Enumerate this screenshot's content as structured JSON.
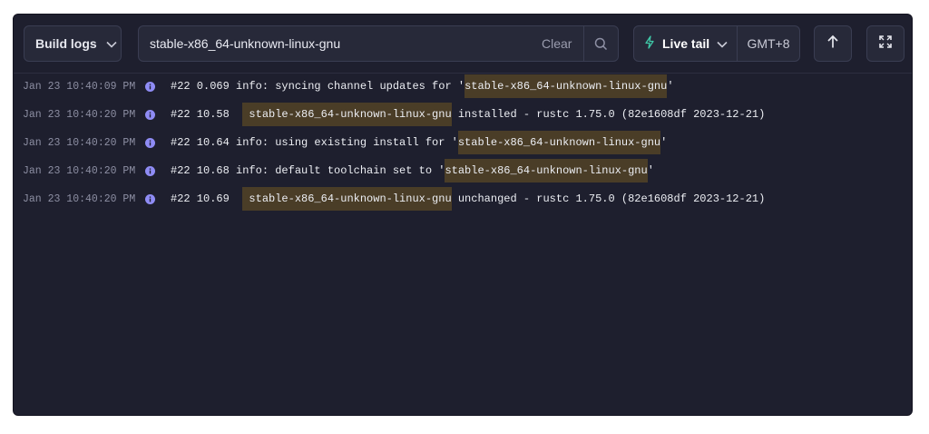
{
  "toolbar": {
    "source_label": "Build logs",
    "search_value": "stable-x86_64-unknown-linux-gnu",
    "clear_label": "Clear",
    "live_tail_label": "Live tail",
    "timezone_label": "GMT+8",
    "icons": {
      "source_dropdown": "chevron-down-icon",
      "search": "search-icon",
      "live_tail": "lightning-bolt-icon",
      "live_tail_dropdown": "chevron-down-icon",
      "scroll_top": "arrow-up-icon",
      "expand": "expand-icon"
    }
  },
  "logs": [
    {
      "timestamp": "Jan 23 10:40:09 PM",
      "level_icon": "info-icon",
      "prefix": "#22 0.069 info: syncing channel updates for '",
      "match": "stable-x86_64-unknown-linux-gnu",
      "suffix": "'"
    },
    {
      "timestamp": "Jan 23 10:40:20 PM",
      "level_icon": "info-icon",
      "prefix": "#22 10.58  ",
      "match": " stable-x86_64-unknown-linux-gnu",
      "suffix": " installed - rustc 1.75.0 (82e1608df 2023-12-21)"
    },
    {
      "timestamp": "Jan 23 10:40:20 PM",
      "level_icon": "info-icon",
      "prefix": "#22 10.64 info: using existing install for '",
      "match": "stable-x86_64-unknown-linux-gnu",
      "suffix": "'"
    },
    {
      "timestamp": "Jan 23 10:40:20 PM",
      "level_icon": "info-icon",
      "prefix": "#22 10.68 info: default toolchain set to '",
      "match": "stable-x86_64-unknown-linux-gnu",
      "suffix": "'"
    },
    {
      "timestamp": "Jan 23 10:40:20 PM",
      "level_icon": "info-icon",
      "prefix": "#22 10.69  ",
      "match": " stable-x86_64-unknown-linux-gnu",
      "suffix": " unchanged - rustc 1.75.0 (82e1608df 2023-12-21)"
    }
  ],
  "colors": {
    "panel_bg": "#1e1f2e",
    "highlight_bg": "#4a3d27",
    "info_icon": "#8f8cf5",
    "live_tail_icon": "#3fc9a8"
  }
}
